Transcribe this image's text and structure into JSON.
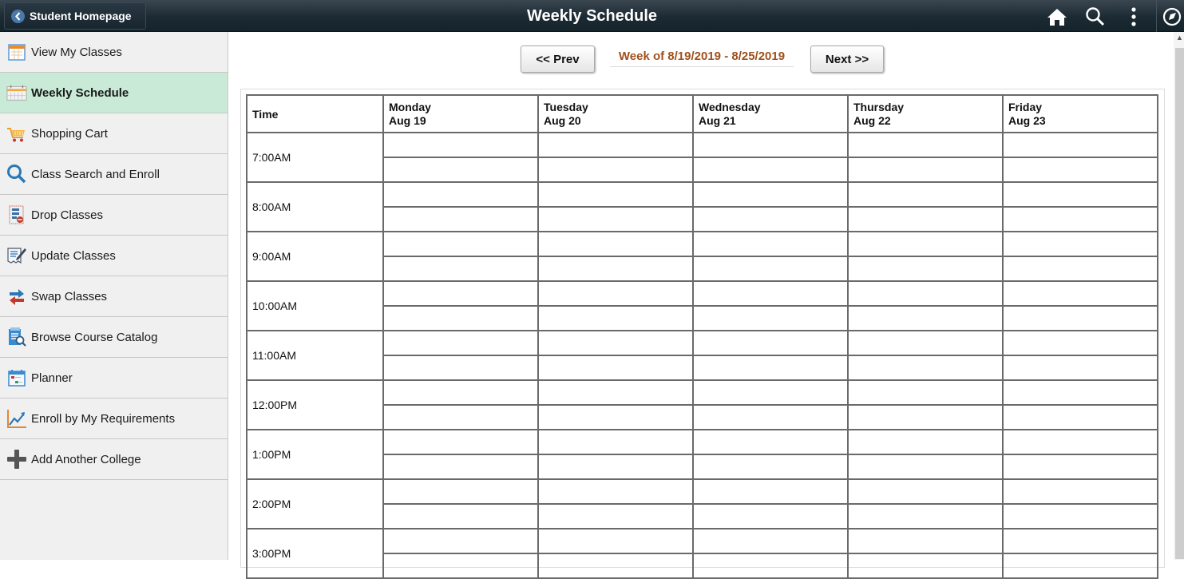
{
  "header": {
    "back_label": "Student Homepage",
    "title": "Weekly Schedule",
    "icons": [
      "home-icon",
      "search-icon",
      "more-vertical-icon",
      "navbar-compass-icon"
    ]
  },
  "sidebar": {
    "items": [
      {
        "label": "View My Classes",
        "icon": "calendar-icon",
        "active": false
      },
      {
        "label": "Weekly Schedule",
        "icon": "weekly-calendar-icon",
        "active": true
      },
      {
        "label": "Shopping Cart",
        "icon": "shopping-cart-icon",
        "active": false
      },
      {
        "label": "Class Search and Enroll",
        "icon": "search-icon",
        "active": false
      },
      {
        "label": "Drop Classes",
        "icon": "drop-list-icon",
        "active": false
      },
      {
        "label": "Update Classes",
        "icon": "edit-document-icon",
        "active": false
      },
      {
        "label": "Swap Classes",
        "icon": "swap-arrows-icon",
        "active": false
      },
      {
        "label": "Browse Course Catalog",
        "icon": "catalog-search-icon",
        "active": false
      },
      {
        "label": "Planner",
        "icon": "planner-icon",
        "active": false
      },
      {
        "label": "Enroll by My Requirements",
        "icon": "trend-chart-icon",
        "active": false
      },
      {
        "label": "Add Another College",
        "icon": "plus-icon",
        "active": false
      }
    ]
  },
  "week_nav": {
    "prev_label": "<< Prev",
    "next_label": "Next >>",
    "week_label": "Week of 8/19/2019 - 8/25/2019"
  },
  "schedule": {
    "time_header": "Time",
    "days": [
      {
        "day": "Monday",
        "date": "Aug 19"
      },
      {
        "day": "Tuesday",
        "date": "Aug 20"
      },
      {
        "day": "Wednesday",
        "date": "Aug 21"
      },
      {
        "day": "Thursday",
        "date": "Aug 22"
      },
      {
        "day": "Friday",
        "date": "Aug 23"
      }
    ],
    "times": [
      "7:00AM",
      "8:00AM",
      "9:00AM",
      "10:00AM",
      "11:00AM",
      "12:00PM",
      "1:00PM",
      "2:00PM",
      "3:00PM"
    ]
  },
  "colors": {
    "active_item_bg": "#c8ead6",
    "week_label": "#a0501c",
    "header_bg": "#1c2a33"
  }
}
